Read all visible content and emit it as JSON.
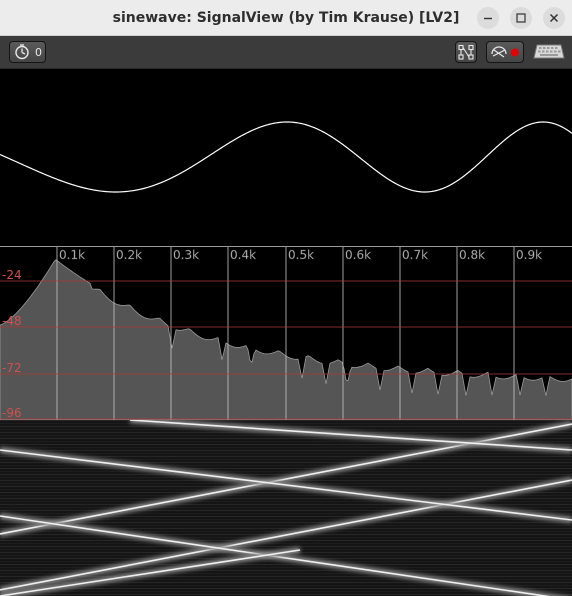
{
  "window": {
    "title": "sinewave: SignalView (by Tim Krause) [LV2]",
    "controls": [
      "minimize-icon",
      "maximize-icon",
      "close-icon"
    ]
  },
  "toolbar": {
    "timer_icon": "timer-icon",
    "counter_value": "0",
    "route_icon": "route-icon",
    "record_icon": "record-icon",
    "keyboard_icon": "keyboard-icon"
  },
  "spectrum": {
    "freq_labels": [
      "0.1k",
      "0.2k",
      "0.3k",
      "0.4k",
      "0.5k",
      "0.6k",
      "0.7k",
      "0.8k",
      "0.9k"
    ],
    "db_labels": [
      "-24",
      "-48",
      "-72",
      "-96"
    ],
    "freq_label_color": "#c8c8c8",
    "db_label_color": "#d05050"
  },
  "colors": {
    "titlebar_bg": "#ececec",
    "toolbar_bg": "#3b3b3b",
    "wave_line": "#ffffff",
    "spectrum_fill": "#555555",
    "grid_vertical": "#c8c8c8",
    "grid_horizontal": "#b03a3a",
    "record_dot": "#e00000"
  }
}
